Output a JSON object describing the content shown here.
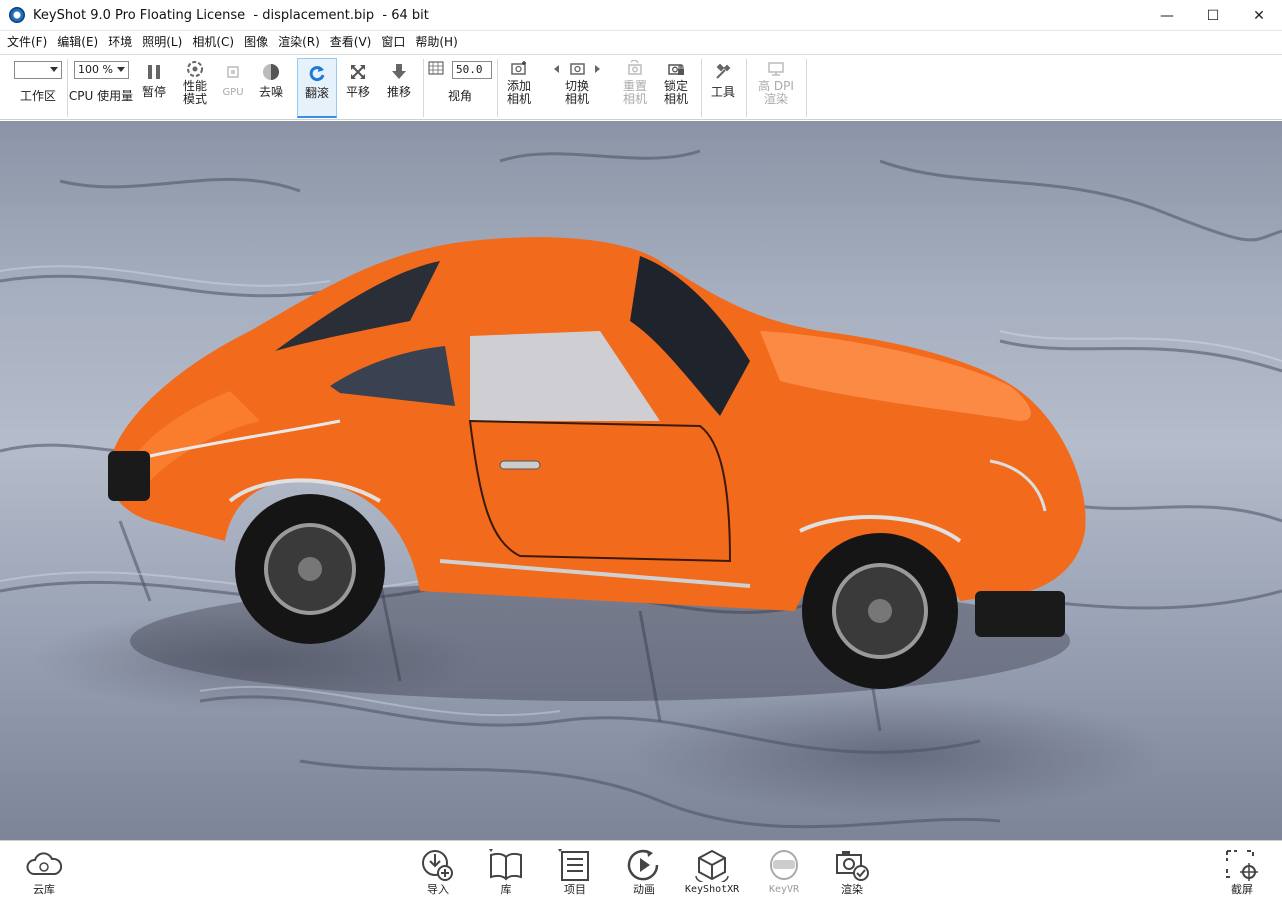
{
  "window": {
    "title": "KeyShot 9.0 Pro Floating License  - displacement.bip  - 64 bit",
    "minimize": "—",
    "maximize": "☐",
    "close": "✕"
  },
  "menu": [
    "文件(F)",
    "编辑(E)",
    "环境",
    "照明(L)",
    "相机(C)",
    "图像",
    "渲染(R)",
    "查看(V)",
    "窗口",
    "帮助(H)"
  ],
  "toolbar": {
    "workspace_label": "工作区",
    "workspace_value": "",
    "cpu_value": "100 %",
    "cpu_label": "CPU 使用量",
    "pause_label": "暂停",
    "performance_label_1": "性能",
    "performance_label_2": "模式",
    "gpu_label": "GPU",
    "denoise_label": "去噪",
    "tumble_label": "翻滚",
    "pan_label": "平移",
    "dolly_label": "推移",
    "fov_value": "50.0",
    "fov_label": "视角",
    "add_camera_1": "添加",
    "add_camera_2": "相机",
    "switch_camera_1": "切换",
    "switch_camera_2": "相机",
    "reset_camera_1": "重置",
    "reset_camera_2": "相机",
    "lock_camera_1": "锁定",
    "lock_camera_2": "相机",
    "tools_label": "工具",
    "hidpi_1": "高 DPI",
    "hidpi_2": "渲染"
  },
  "bottombar": {
    "cloud_label": "云库",
    "import_label": "导入",
    "library_label": "库",
    "project_label": "项目",
    "animation_label": "动画",
    "keyshotxr_label": "KeyShotXR",
    "keyvr_label": "KeyVR",
    "render_label": "渲染",
    "screenshot_label": "截屏"
  },
  "colors": {
    "accent": "#3a8ee6",
    "car_orange": "#f26a1b",
    "ground": "#a7b0c0"
  }
}
